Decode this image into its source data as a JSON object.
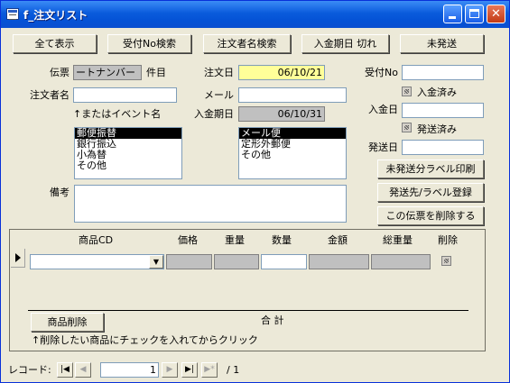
{
  "window": {
    "title": "f_注文リスト"
  },
  "toolbar": {
    "show_all": "全て表示",
    "search_receipt_no": "受付No検索",
    "search_customer": "注文者名検索",
    "payment_overdue": "入金期日 切れ",
    "unshipped": "未発送"
  },
  "form": {
    "denpyo_label": "伝票",
    "denpyo_value": "ートナンバー",
    "kenmoku_label": "件目",
    "order_date_label": "注文日",
    "order_date_value": "06/10/21",
    "receipt_no_label": "受付No",
    "receipt_no_value": "",
    "customer_label": "注文者名",
    "customer_value": "",
    "email_label": "メール",
    "email_value": "",
    "paid_check_label": "入金済み",
    "customer_hint": "↑またはイベント名",
    "payment_due_label": "入金期日",
    "payment_due_value": "06/10/31",
    "payment_date_label": "入金日",
    "payment_date_value": "",
    "shipped_check_label": "発送済み",
    "ship_date_label": "発送日",
    "ship_date_value": "",
    "notes_label": "備考",
    "notes_value": "",
    "payment_methods": [
      {
        "label": "郵便振替",
        "selected": true
      },
      {
        "label": "銀行振込",
        "selected": false
      },
      {
        "label": "小為替",
        "selected": false
      },
      {
        "label": "その他",
        "selected": false
      }
    ],
    "delivery_methods": [
      {
        "label": "メール便",
        "selected": true
      },
      {
        "label": "定形外郵便",
        "selected": false
      },
      {
        "label": "その他",
        "selected": false
      }
    ]
  },
  "actions": {
    "print_unshipped_labels": "未発送分ラベル印刷",
    "register_label": "発送先/ラベル登録",
    "delete_slip": "この伝票を削除する"
  },
  "subform": {
    "columns": {
      "product_cd": "商品CD",
      "price": "価格",
      "weight": "重量",
      "quantity": "数量",
      "amount": "金額",
      "total_weight": "総重量",
      "delete": "削除"
    },
    "delete_product_button": "商品削除",
    "total_label": "合 計",
    "hint": "↑削除したい商品にチェックを入れてからクリック"
  },
  "record_nav": {
    "label": "レコード:",
    "current": "1",
    "total_text": "/ 1"
  }
}
